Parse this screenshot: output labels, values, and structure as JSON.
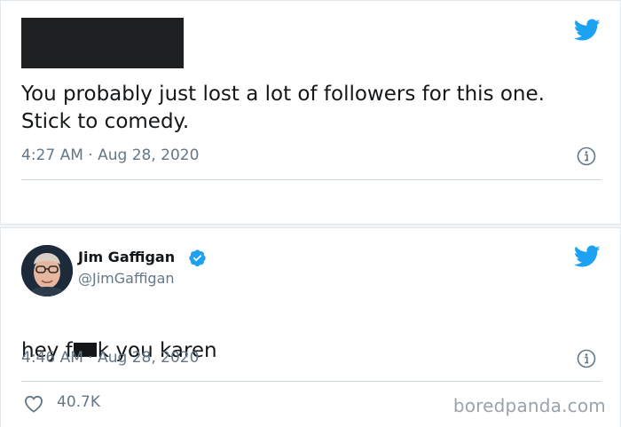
{
  "tweets": [
    {
      "author_redacted": true,
      "text": "You probably just lost a lot of followers for this one.\nStick to comedy.",
      "time": "4:27 AM",
      "date": "Aug 28, 2020"
    },
    {
      "author": {
        "display_name": "Jim Gaffigan",
        "handle": "@JimGaffigan",
        "verified": true
      },
      "text_before": "hey f",
      "text_after": "k you karen",
      "time": "4:46 AM",
      "date": "Aug 28, 2020",
      "likes": "40.7K"
    }
  ],
  "separator": "·",
  "watermark": "boredpanda.com",
  "icons": {
    "twitter": "twitter-bird-icon",
    "info": "info-icon",
    "verified": "verified-badge-icon",
    "like": "heart-icon"
  },
  "colors": {
    "twitter_blue": "#1da1f2",
    "text": "#14171a",
    "muted": "#657786",
    "divider": "#ccd6dd"
  }
}
